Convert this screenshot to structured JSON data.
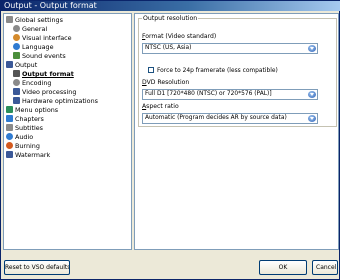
{
  "window": {
    "title": "Output - Output format"
  },
  "tree": {
    "items": [
      {
        "label": "Global settings",
        "icon": "settings-icon",
        "color": "#8a8a8a"
      },
      {
        "label": "General",
        "icon": "gear-icon",
        "color": "#8a8a8a"
      },
      {
        "label": "Visual interface",
        "icon": "palette-icon",
        "color": "#d48a2c"
      },
      {
        "label": "Language",
        "icon": "globe-icon",
        "color": "#2f7bd1"
      },
      {
        "label": "Sound events",
        "icon": "speaker-icon",
        "color": "#4c8f3c"
      },
      {
        "label": "Output",
        "icon": "monitor-icon",
        "color": "#3b5998"
      },
      {
        "label": "Output format",
        "icon": "film-icon",
        "color": "#555555"
      },
      {
        "label": "Encoding",
        "icon": "gear-icon",
        "color": "#8a8a8a"
      },
      {
        "label": "Video processing",
        "icon": "video-icon",
        "color": "#3b5998"
      },
      {
        "label": "Hardware optimizations",
        "icon": "chip-icon",
        "color": "#3b5998"
      },
      {
        "label": "Menu options",
        "icon": "menu-icon",
        "color": "#2a8f5a"
      },
      {
        "label": "Chapters",
        "icon": "chapters-icon",
        "color": "#2f7bd1"
      },
      {
        "label": "Subtitles",
        "icon": "subtitles-icon",
        "color": "#8a8a8a"
      },
      {
        "label": "Audio",
        "icon": "music-note-icon",
        "color": "#2f7bd1"
      },
      {
        "label": "Burning",
        "icon": "flame-icon",
        "color": "#d45a1e"
      },
      {
        "label": "Watermark",
        "icon": "watermark-icon",
        "color": "#3b5998"
      }
    ]
  },
  "output_resolution": {
    "legend": "Output resolution",
    "format_label_underlined": "F",
    "format_label_rest": "ormat (Video standard)",
    "format_value": "NTSC (US, Asia)",
    "force_label": "Force to 24p framerate (less compatible)",
    "dvd_label_underlined": "D",
    "dvd_label_rest": "VD Resolution",
    "dvd_value": "Full D1 [720*480 (NTSC) or 720*576 (PAL)]",
    "aspect_label_underlined": "A",
    "aspect_label_rest": "spect ratio",
    "aspect_value": "Automatic (Program decides AR by source data)"
  },
  "buttons": {
    "reset": "Reset to VSO defaults",
    "ok": "OK",
    "cancel": "Cancel"
  }
}
